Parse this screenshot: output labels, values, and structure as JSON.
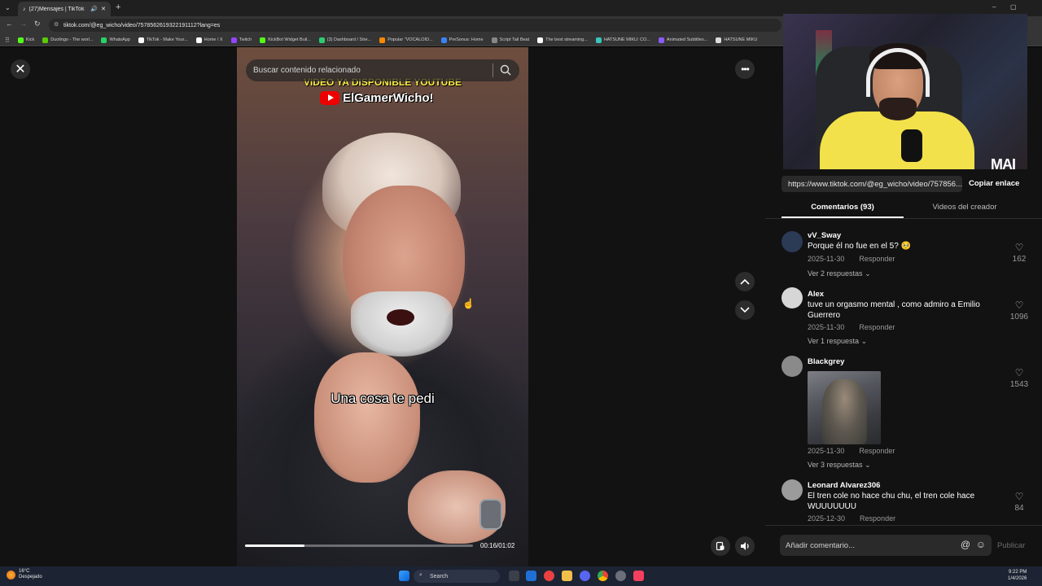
{
  "browser": {
    "tab_title": "(27)Mensajes | TikTok",
    "address": "tiktok.com/@eg_wicho/video/7578562619322191112?lang=es",
    "bookmarks": [
      {
        "label": "Kick",
        "color": "#53fc18"
      },
      {
        "label": "Duolingo - The worl...",
        "color": "#58cc02"
      },
      {
        "label": "WhatsApp",
        "color": "#25d366"
      },
      {
        "label": "TikTok - Make Your...",
        "color": "#ffffff"
      },
      {
        "label": "Home / X",
        "color": "#ffffff"
      },
      {
        "label": "Twitch",
        "color": "#9146ff"
      },
      {
        "label": "KickBot Widget Buil...",
        "color": "#53fc18"
      },
      {
        "label": "(3) Dashboard / Stre...",
        "color": "#2ecc71"
      },
      {
        "label": "Popular \"VOCALOID...",
        "color": "#ff8800"
      },
      {
        "label": "PreSonus: Home",
        "color": "#3b82f6"
      },
      {
        "label": "Script Tail Beat",
        "color": "#888888"
      },
      {
        "label": "The best streaming...",
        "color": "#ffffff"
      },
      {
        "label": "HATSUNE MIKU: CO...",
        "color": "#39c5bb"
      },
      {
        "label": "Animated Subtitles...",
        "color": "#8b5cf6"
      },
      {
        "label": "HATSUNE MIKU",
        "color": "#dddddd"
      }
    ]
  },
  "video": {
    "search_placeholder": "Buscar contenido relacionado",
    "overlay_title": "VIDEO YA DISPONIBLE YOUTUBE",
    "overlay_channel": "ElGamerWicho!",
    "caption": "Una cosa te pedi",
    "timecode": "00:16/01:02",
    "progress_fraction": 0.26
  },
  "webcam": {
    "brand": "MAI"
  },
  "panel": {
    "link": "https://www.tiktok.com/@eg_wicho/video/757856...",
    "copy_label": "Copiar enlace",
    "tab_comments": "Comentarios (93)",
    "tab_creator": "Videos del creador",
    "comments": [
      {
        "user": "vV_Sway",
        "text": "Porque él no fue en el 5? 🥺",
        "date": "2025-11-30",
        "reply": "Responder",
        "replies": "Ver 2 respuestas",
        "likes": "162",
        "avatar_color": "#2b3a55"
      },
      {
        "user": "Alex",
        "text": "tuve un orgasmo mental , como admiro a Emilio Guerrero",
        "date": "2025-11-30",
        "reply": "Responder",
        "replies": "Ver 1 respuesta",
        "likes": "1096",
        "avatar_color": "#d6d6d6"
      },
      {
        "user": "Blackgrey",
        "text": "",
        "date": "2025-11-30",
        "reply": "Responder",
        "replies": "Ver 3 respuestas",
        "likes": "1543",
        "avatar_color": "#8a8a8a"
      },
      {
        "user": "Leonard Alvarez306",
        "text": "El tren cole no hace chu chu, el tren cole hace WUUUUUUU",
        "date": "2025-12-30",
        "reply": "Responder",
        "replies": "",
        "likes": "84",
        "avatar_color": "#9b9b9b"
      }
    ],
    "add_comment_placeholder": "Añadir comentario...",
    "publish_label": "Publicar"
  },
  "taskbar": {
    "temperature": "16°C",
    "weather": "Despejado",
    "search": "Search",
    "time": "9:22 PM",
    "date": "1/4/2026"
  }
}
